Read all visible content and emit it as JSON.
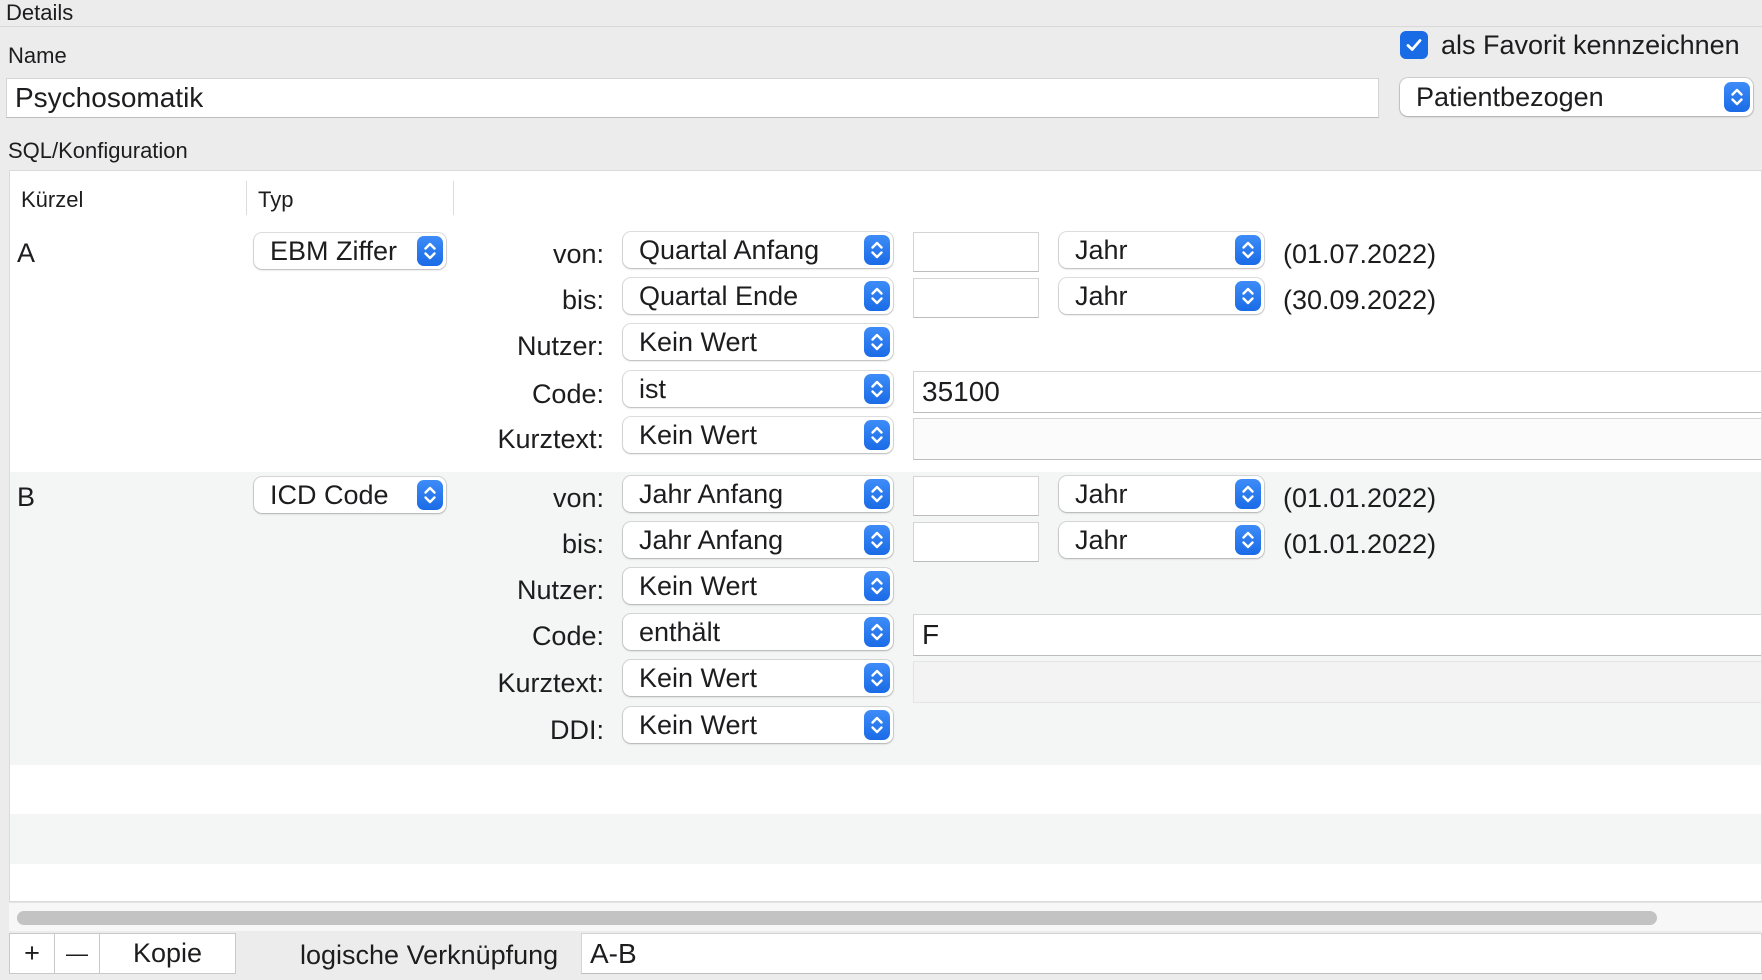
{
  "details": {
    "title": "Details",
    "name_label": "Name",
    "name_value": "Psychosomatik",
    "favorite_label": "als Favorit kennzeichnen",
    "favorite_checked": true,
    "scope_value": "Patientbezogen",
    "sql_label": "SQL/Konfiguration"
  },
  "table": {
    "headers": [
      "Kürzel",
      "Typ"
    ],
    "rows": [
      {
        "kurzel": "A",
        "typ": "EBM Ziffer",
        "von_label": "von:",
        "von_value": "Quartal Anfang",
        "von_unit": "Jahr",
        "von_date": "(01.07.2022)",
        "bis_label": "bis:",
        "bis_value": "Quartal Ende",
        "bis_unit": "Jahr",
        "bis_date": "(30.09.2022)",
        "nutzer_label": "Nutzer:",
        "nutzer_value": "Kein Wert",
        "code_label": "Code:",
        "code_op": "ist",
        "code_value": "35100",
        "kurztext_label": "Kurztext:",
        "kurztext_value": "Kein Wert"
      },
      {
        "kurzel": "B",
        "typ": "ICD Code",
        "von_label": "von:",
        "von_value": "Jahr Anfang",
        "von_unit": "Jahr",
        "von_date": "(01.01.2022)",
        "bis_label": "bis:",
        "bis_value": "Jahr Anfang",
        "bis_unit": "Jahr",
        "bis_date": "(01.01.2022)",
        "nutzer_label": "Nutzer:",
        "nutzer_value": "Kein Wert",
        "code_label": "Code:",
        "code_op": "enthält",
        "code_value": "F",
        "kurztext_label": "Kurztext:",
        "kurztext_value": "Kein Wert",
        "ddi_label": "DDI:",
        "ddi_value": "Kein Wert"
      }
    ]
  },
  "footer": {
    "add_symbol": "+",
    "remove_symbol": "—",
    "copy_label": "Kopie",
    "logic_label": "logische Verknüpfung",
    "logic_value": "A-B"
  },
  "colors": {
    "accent": "#1a6be6",
    "window_bg": "#ececec",
    "row_alt": "#f4f5f5"
  }
}
